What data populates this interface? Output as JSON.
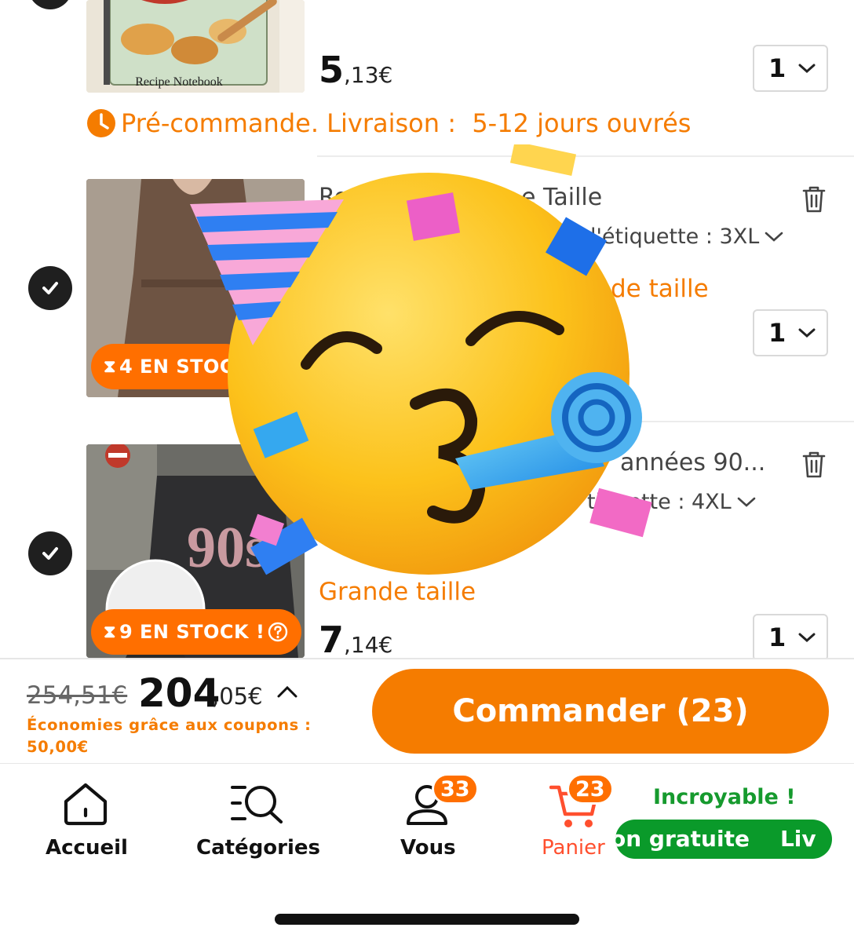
{
  "items": [
    {
      "image_caption": "Recipe Notebook",
      "price_int": "5",
      "price_dec": ",13€",
      "qty": "1",
      "preorder_text": "Pré-commande. Livraison :  5-12 jours ouvrés"
    },
    {
      "title_start": "Ro",
      "title_end": "e Taille",
      "attr": "l'étiquette : 3XL",
      "tag_partial": "de taille",
      "qty": "1",
      "stock_label": "4 EN STOC"
    },
    {
      "title_end": "années 90...",
      "attr": "tiquette : 4XL",
      "tag": "Grande taille",
      "price_int": "7",
      "price_dec": ",14€",
      "qty": "1",
      "stock_label": "9 EN STOCK !",
      "image_text": "90s"
    }
  ],
  "checkout": {
    "old_price": "254,51€",
    "total_int": "204",
    "total_dec": ",05€",
    "savings": "Économies grâce aux coupons : 50,00€",
    "order_label": "Commander (23)"
  },
  "tabbar": {
    "home": "Accueil",
    "categories": "Catégories",
    "you": "Vous",
    "you_badge": "33",
    "cart": "Panier",
    "cart_badge": "23",
    "promo_title": "Incroyable !",
    "promo_ticker": "on gratuite    Liv"
  },
  "colors": {
    "accent_orange": "#f57c00",
    "promo_green": "#0a9a2a"
  }
}
